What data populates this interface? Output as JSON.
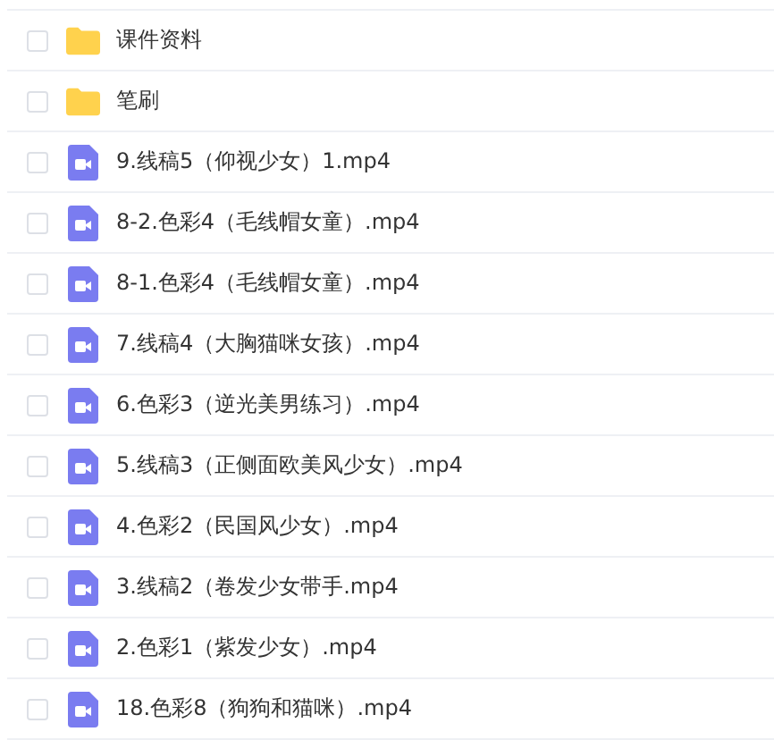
{
  "files": [
    {
      "kind": "folder",
      "name": "课件资料",
      "checked": false
    },
    {
      "kind": "folder",
      "name": "笔刷",
      "checked": false
    },
    {
      "kind": "video",
      "name": "9.线稿5（仰视少女）1.mp4",
      "checked": false
    },
    {
      "kind": "video",
      "name": "8-2.色彩4（毛线帽女童）.mp4",
      "checked": false
    },
    {
      "kind": "video",
      "name": "8-1.色彩4（毛线帽女童）.mp4",
      "checked": false
    },
    {
      "kind": "video",
      "name": "7.线稿4（大胸猫咪女孩）.mp4",
      "checked": false
    },
    {
      "kind": "video",
      "name": "6.色彩3（逆光美男练习）.mp4",
      "checked": false
    },
    {
      "kind": "video",
      "name": "5.线稿3（正侧面欧美风少女）.mp4",
      "checked": false
    },
    {
      "kind": "video",
      "name": "4.色彩2（民国风少女）.mp4",
      "checked": false
    },
    {
      "kind": "video",
      "name": "3.线稿2（卷发少女带手.mp4",
      "checked": false
    },
    {
      "kind": "video",
      "name": "2.色彩1（紫发少女）.mp4",
      "checked": false
    },
    {
      "kind": "video",
      "name": "18.色彩8（狗狗和猫咪）.mp4",
      "checked": false
    }
  ]
}
